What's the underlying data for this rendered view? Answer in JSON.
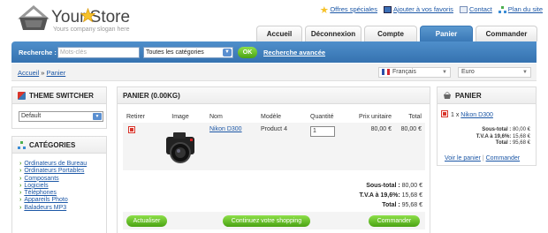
{
  "header": {
    "title": "Your Store",
    "slogan": "Yours company slogan here",
    "links": [
      {
        "label": "Offres spéciales",
        "icon": "star-icon"
      },
      {
        "label": "Ajouter à vos favoris",
        "icon": "bookmark-icon"
      },
      {
        "label": "Contact",
        "icon": "mail-icon"
      },
      {
        "label": "Plan du site",
        "icon": "sitemap-icon"
      }
    ]
  },
  "tabs": [
    "Accueil",
    "Déconnexion",
    "Compte",
    "Panier",
    "Commander"
  ],
  "search": {
    "label": "Recherche :",
    "placeholder": "Mots-clés",
    "category": "Toutes les catégories",
    "ok": "OK",
    "advanced": "Recherche avancée"
  },
  "breadcrumb": {
    "home": "Accueil",
    "sep": " » ",
    "current": "Panier"
  },
  "language": "Français",
  "currency": "Euro",
  "theme_switcher": {
    "title": "THEME SWITCHER",
    "selected": "Default"
  },
  "categories": {
    "title": "CATÉGORIES",
    "items": [
      "Ordinateurs de Bureau",
      "Ordinateurs Portables",
      "Composants",
      "Logiciels",
      "Téléphones",
      "Appareils Photo",
      "Baladeurs MP3"
    ]
  },
  "cart": {
    "title": "PANIER  (0.00KG)",
    "headers": [
      "Retirer",
      "Image",
      "Nom",
      "Modèle",
      "Quantité",
      "Prix unitaire",
      "Total"
    ],
    "row": {
      "name": "Nikon D300",
      "model": "Product 4",
      "quantity": "1",
      "unit_price": "80,00 €",
      "total": "80,00 €"
    },
    "subtotal_label": "Sous-total :",
    "subtotal": "80,00 €",
    "tva_label": "T.V.A à 19,6%:",
    "tva": "15,68 €",
    "total_label": "Total :",
    "total": "95,68 €",
    "buttons": {
      "update": "Actualiser",
      "continue": "Continuez votre shopping",
      "checkout": "Commander"
    }
  },
  "mini_cart": {
    "title": "PANIER",
    "item_qty": "1 x",
    "item_name": "Nikon D300",
    "subtotal_label": "Sous-total :",
    "subtotal": "80,00 €",
    "tva_label": "T.V.A à 19,6%:",
    "tva": "15,68 €",
    "total_label": "Total :",
    "total": "95,68 €",
    "view_cart": "Voir le panier",
    "sep": "|",
    "checkout": "Commander"
  }
}
